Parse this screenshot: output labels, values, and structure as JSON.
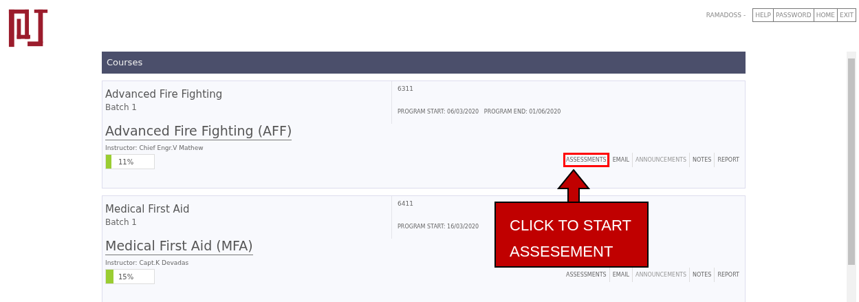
{
  "user_nav": {
    "user": "RAMADOSS -",
    "links": [
      "HELP",
      "PASSWORD",
      "HOME",
      "EXIT"
    ]
  },
  "panel": {
    "title": "Courses"
  },
  "courses": [
    {
      "name": "Advanced Fire Fighting",
      "batch": "Batch 1",
      "full_title": "Advanced Fire Fighting (AFF)",
      "instructor": "Instructor: Chief Engr.V Mathew",
      "level": 0.11,
      "percent": "11%",
      "code": "6311",
      "dates": "PROGRAM START: 06/03/2020   PROGRAM END: 01/06/2020",
      "highlighted": true,
      "actions": [
        {
          "label": "ASSESSMENTS",
          "disabled": false
        },
        {
          "label": "EMAIL",
          "disabled": false
        },
        {
          "label": "ANNOUNCEMENTS",
          "disabled": true
        },
        {
          "label": "NOTES",
          "disabled": false
        },
        {
          "label": "REPORT",
          "disabled": false
        }
      ]
    },
    {
      "name": "Medical First Aid",
      "batch": "Batch 1",
      "full_title": "Medical First Aid (MFA)",
      "instructor": "Instructor: Capt.K Devadas",
      "level": 0.15,
      "percent": "15%",
      "code": "6411",
      "dates": "PROGRAM START: 16/03/2020",
      "highlighted": false,
      "actions": [
        {
          "label": "ASSESSMENTS",
          "disabled": false
        },
        {
          "label": "EMAIL",
          "disabled": false
        },
        {
          "label": "ANNOUNCEMENTS",
          "disabled": true
        },
        {
          "label": "NOTES",
          "disabled": false
        },
        {
          "label": "REPORT",
          "disabled": false
        }
      ]
    }
  ],
  "callout": {
    "text": "CLICK TO START ASSESEMENT"
  }
}
